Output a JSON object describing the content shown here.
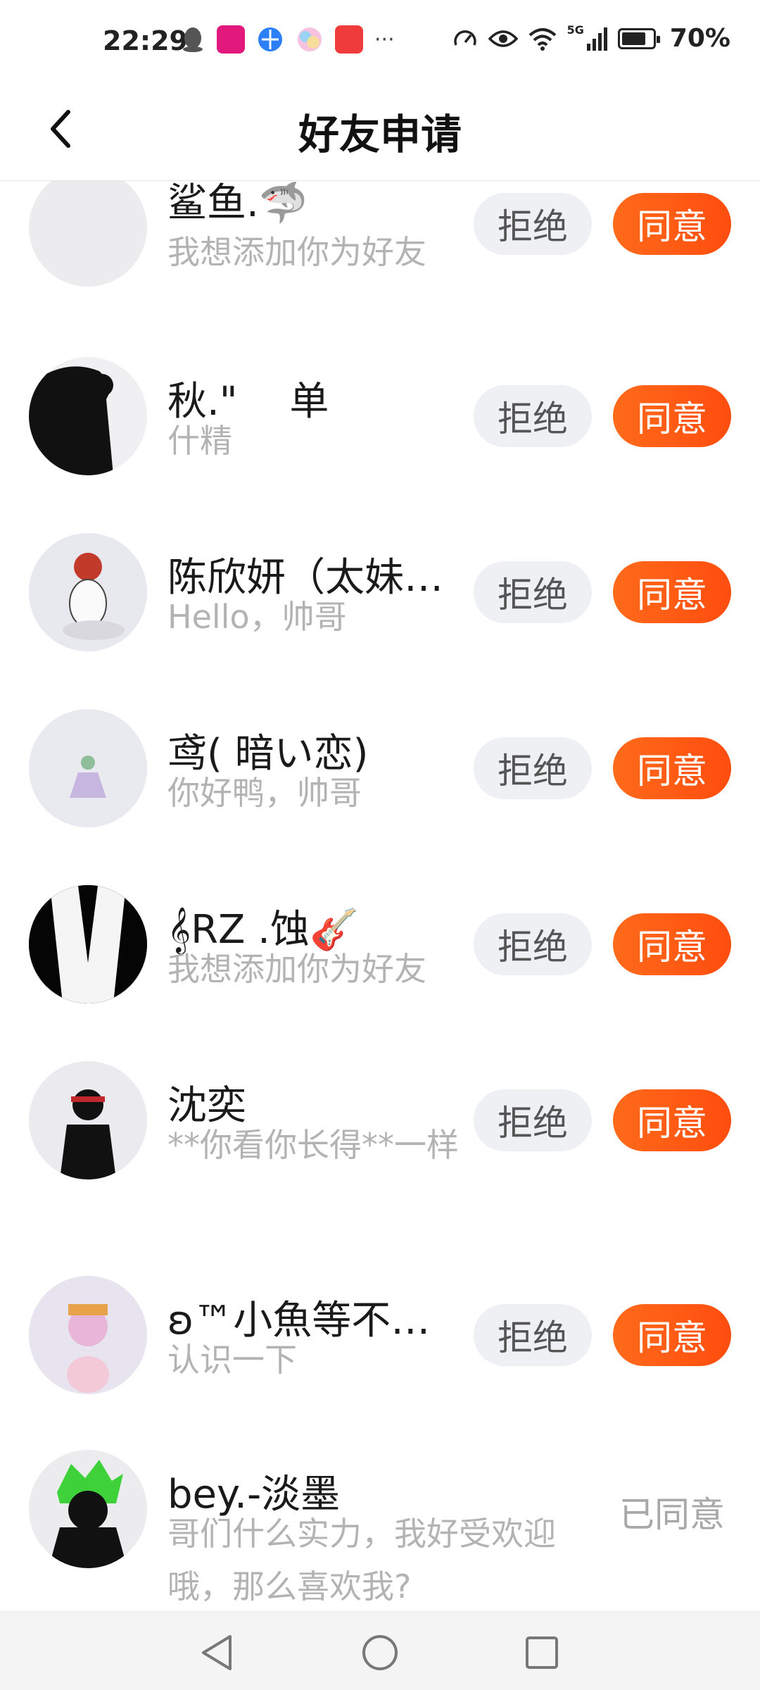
{
  "status_bar": {
    "time": "22:29",
    "notification_icons": [
      "qq-icon",
      "vipshop-icon",
      "browser-icon",
      "gallery-icon",
      "huawei-store-icon"
    ],
    "more": "···",
    "battery_percent": "70%",
    "network_label": "5G"
  },
  "header": {
    "title": "好友申请"
  },
  "labels": {
    "reject": "拒绝",
    "accept": "同意",
    "accepted": "已同意"
  },
  "requests": [
    {
      "name": "鲨鱼.🦈",
      "message": "我想添加你为好友",
      "status": "pending"
    },
    {
      "name": "秋.\"　 单",
      "message": "什精",
      "status": "pending"
    },
    {
      "name": "陈欣妍（太妹…",
      "message": "Hello，帅哥",
      "status": "pending"
    },
    {
      "name": "鸢( 暗い恋)",
      "message": "你好鸭，帅哥",
      "status": "pending"
    },
    {
      "name": "𝄞RZ .蚀🎸",
      "message": "我想添加你为好友",
      "status": "pending"
    },
    {
      "name": "沈奕",
      "message": "**你看你长得**一样",
      "status": "pending"
    },
    {
      "name": "ʚ™小魚等不…",
      "message": "认识一下",
      "status": "pending"
    },
    {
      "name": "bey.-淡墨",
      "message": "哥们什么实力，我好受欢迎哦，那么喜欢我?",
      "status": "accepted"
    }
  ],
  "colors": {
    "accent": "#ff5a14",
    "reject_bg": "#eef0f4",
    "secondary_text": "#b3b3b3"
  }
}
